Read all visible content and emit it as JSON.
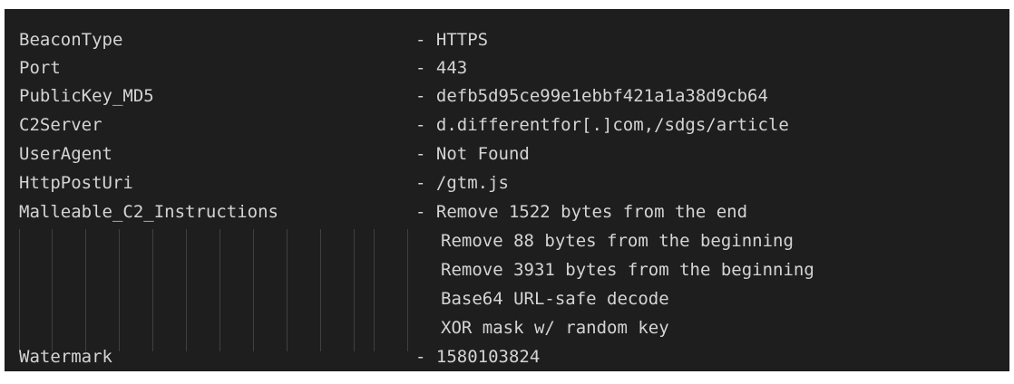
{
  "colors": {
    "background": "#1e1e1e",
    "text": "#d4d4d4",
    "indent_guide": "#404040"
  },
  "rows": [
    {
      "key": "BeaconType",
      "value": "- HTTPS"
    },
    {
      "key": "Port",
      "value": "- 443"
    },
    {
      "key": "PublicKey_MD5",
      "value": "- defb5d95ce99e1ebbf421a1a38d9cb64"
    },
    {
      "key": "C2Server",
      "value": "- d.differentfor[.]com,/sdgs/article"
    },
    {
      "key": "UserAgent",
      "value": "- Not Found"
    },
    {
      "key": "HttpPostUri",
      "value": "- /gtm.js"
    },
    {
      "key": "Malleable_C2_Instructions",
      "value": "- Remove 1522 bytes from the end"
    }
  ],
  "continuation": [
    "Remove 88 bytes from the beginning",
    "Remove 3931 bytes from the beginning",
    "Base64 URL-safe decode",
    "XOR mask w/ random key"
  ],
  "footer_row": {
    "key": "Watermark",
    "value": "- 1580103824"
  }
}
